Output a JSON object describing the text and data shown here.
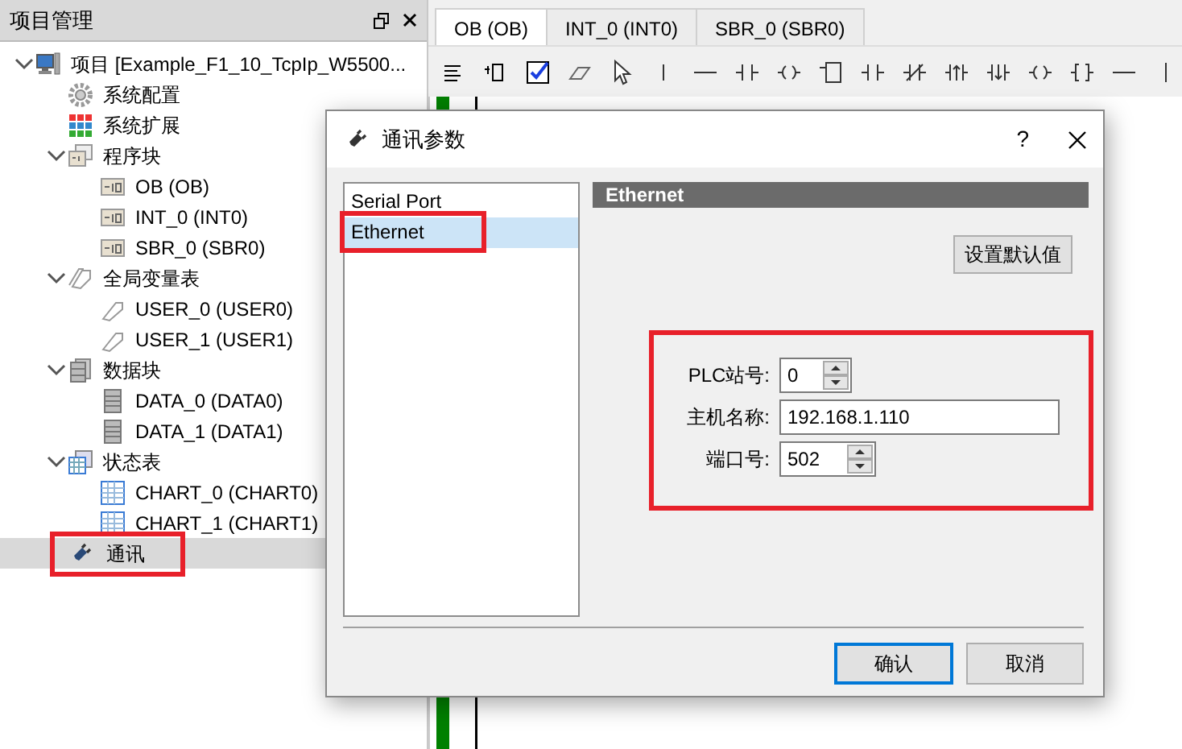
{
  "project_panel": {
    "title": "项目管理",
    "tree": [
      {
        "label": "项目 [Example_F1_10_TcpIp_W5500...",
        "kind": "computer",
        "expanded": true,
        "selected": false,
        "children": [
          {
            "label": "系统配置",
            "kind": "gear",
            "selected": false
          },
          {
            "label": "系统扩展",
            "kind": "modules",
            "selected": false
          },
          {
            "label": "程序块",
            "kind": "blocks",
            "expanded": true,
            "selected": false,
            "children": [
              {
                "label": "OB (OB)",
                "kind": "block",
                "selected": false
              },
              {
                "label": "INT_0 (INT0)",
                "kind": "block",
                "selected": false
              },
              {
                "label": "SBR_0 (SBR0)",
                "kind": "block",
                "selected": false
              }
            ]
          },
          {
            "label": "全局变量表",
            "kind": "tags",
            "expanded": true,
            "selected": false,
            "children": [
              {
                "label": "USER_0 (USER0)",
                "kind": "tag",
                "selected": false
              },
              {
                "label": "USER_1 (USER1)",
                "kind": "tag",
                "selected": false
              }
            ]
          },
          {
            "label": "数据块",
            "kind": "databases",
            "expanded": true,
            "selected": false,
            "children": [
              {
                "label": "DATA_0 (DATA0)",
                "kind": "database",
                "selected": false
              },
              {
                "label": "DATA_1 (DATA1)",
                "kind": "database",
                "selected": false
              }
            ]
          },
          {
            "label": "状态表",
            "kind": "tables",
            "expanded": true,
            "selected": false,
            "children": [
              {
                "label": "CHART_0 (CHART0)",
                "kind": "table",
                "selected": false
              },
              {
                "label": "CHART_1 (CHART1)",
                "kind": "table",
                "selected": false
              }
            ]
          },
          {
            "label": "通讯",
            "kind": "plug",
            "selected": true,
            "highlighted": true
          }
        ]
      }
    ]
  },
  "editor_tabs": [
    {
      "label": "OB (OB)",
      "selected": true
    },
    {
      "label": "INT_0 (INT0)",
      "selected": false
    },
    {
      "label": "SBR_0 (SBR0)",
      "selected": false
    }
  ],
  "dialog": {
    "title": "通讯参数",
    "help": "?",
    "ports": [
      {
        "label": "Serial Port",
        "selected": false
      },
      {
        "label": "Ethernet",
        "selected": true,
        "highlighted": true
      }
    ],
    "section_title": "Ethernet",
    "defaults_button": "设置默认值",
    "fields_highlighted": true,
    "fields": [
      {
        "label": "PLC站号:",
        "value": "0",
        "kind": "spin"
      },
      {
        "label": "主机名称:",
        "value": "192.168.1.110",
        "kind": "text"
      },
      {
        "label": "端口号:",
        "value": "502",
        "kind": "spin"
      }
    ],
    "ok_button": "确认",
    "cancel_button": "取消"
  }
}
